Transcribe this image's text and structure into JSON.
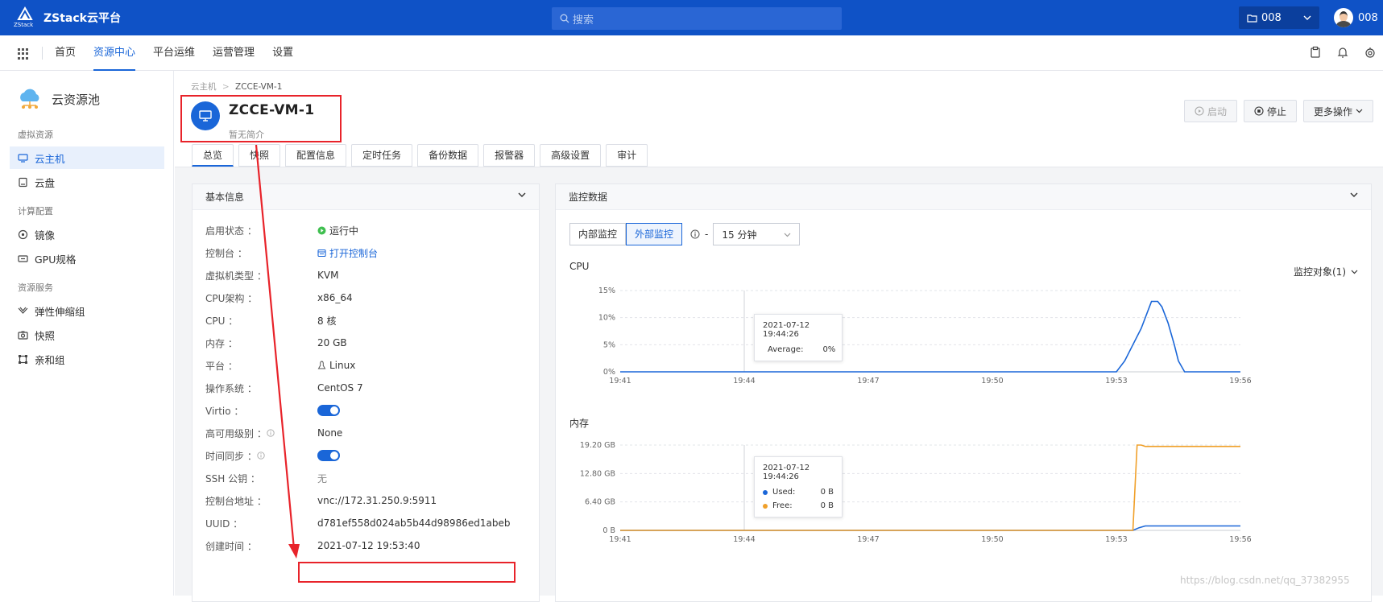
{
  "topbar": {
    "logo_sub": "ZStack",
    "app_name": "ZStack云平台",
    "search_placeholder": "搜索",
    "project": "008",
    "user": "008"
  },
  "nav": {
    "items": [
      {
        "label": "首页",
        "active": false
      },
      {
        "label": "资源中心",
        "active": true
      },
      {
        "label": "平台运维",
        "active": false
      },
      {
        "label": "运营管理",
        "active": false
      },
      {
        "label": "设置",
        "active": false
      }
    ]
  },
  "sidebar": {
    "pool_title": "云资源池",
    "sections": [
      {
        "title": "虚拟资源",
        "items": [
          {
            "label": "云主机",
            "icon": "monitor-icon",
            "active": true
          },
          {
            "label": "云盘",
            "icon": "disk-icon",
            "active": false
          }
        ]
      },
      {
        "title": "计算配置",
        "items": [
          {
            "label": "镜像",
            "icon": "image-icon",
            "active": false
          },
          {
            "label": "GPU规格",
            "icon": "gpu-icon",
            "active": false
          }
        ]
      },
      {
        "title": "资源服务",
        "items": [
          {
            "label": "弹性伸缩组",
            "icon": "scaling-icon",
            "active": false
          },
          {
            "label": "快照",
            "icon": "camera-icon",
            "active": false
          },
          {
            "label": "亲和组",
            "icon": "affinity-icon",
            "active": false
          }
        ]
      }
    ]
  },
  "breadcrumb": {
    "parent": "云主机",
    "sep": ">",
    "current": "ZCCE-VM-1"
  },
  "vm": {
    "name": "ZCCE-VM-1",
    "description": "暂无简介"
  },
  "actions": {
    "start": "启动",
    "stop": "停止",
    "more": "更多操作"
  },
  "tabs": [
    "总览",
    "快照",
    "配置信息",
    "定时任务",
    "备份数据",
    "报警器",
    "高级设置",
    "审计"
  ],
  "basic_info": {
    "title": "基本信息",
    "rows": [
      {
        "label": "启用状态 ：",
        "value": "运行中"
      },
      {
        "label": "控制台 ：",
        "value": "打开控制台"
      },
      {
        "label": "虚拟机类型 ：",
        "value": "KVM"
      },
      {
        "label": "CPU架构 ：",
        "value": "x86_64"
      },
      {
        "label": "CPU ：",
        "value": "8 核"
      },
      {
        "label": "内存 ：",
        "value": "20 GB"
      },
      {
        "label": "平台 ：",
        "value": "Linux"
      },
      {
        "label": "操作系统 ：",
        "value": "CentOS 7"
      },
      {
        "label": "Virtio ：",
        "value": ""
      },
      {
        "label": "高可用级别 ：",
        "value": "None"
      },
      {
        "label": "时间同步 ：",
        "value": ""
      },
      {
        "label": "SSH 公钥 ：",
        "value": "无"
      },
      {
        "label": "控制台地址 ：",
        "value": "vnc://172.31.250.9:5911"
      },
      {
        "label": "UUID ：",
        "value": "d781ef558d024ab5b44d98986ed1abeb"
      },
      {
        "label": "创建时间 ：",
        "value": "2021-07-12 19:53:40"
      }
    ]
  },
  "monitor": {
    "title": "监控数据",
    "internal": "内部监控",
    "external": "外部监控",
    "dash": "-",
    "range": "15 分钟",
    "target": "监控对象(1)"
  },
  "chart_data": [
    {
      "type": "line",
      "title": "CPU",
      "x": [
        "19:41",
        "19:44",
        "19:47",
        "19:50",
        "19:53",
        "19:56"
      ],
      "yticks": [
        "0%",
        "5%",
        "10%",
        "15%"
      ],
      "ylim": [
        0,
        15
      ],
      "series": [
        {
          "name": "Average",
          "color": "#1a66d8",
          "points": [
            [
              0,
              0
            ],
            [
              12.0,
              0
            ],
            [
              12.2,
              2
            ],
            [
              12.4,
              5
            ],
            [
              12.6,
              8
            ],
            [
              12.75,
              11
            ],
            [
              12.85,
              13
            ],
            [
              13.0,
              13
            ],
            [
              13.1,
              12
            ],
            [
              13.25,
              9
            ],
            [
              13.4,
              5
            ],
            [
              13.5,
              2
            ],
            [
              13.65,
              0
            ],
            [
              15,
              0
            ]
          ]
        }
      ],
      "tooltip": {
        "time": "2021-07-12 19:44:26",
        "rows": [
          {
            "label": "Average:",
            "value": "0%",
            "color": "#1a66d8"
          }
        ]
      }
    },
    {
      "type": "line",
      "title": "内存",
      "x": [
        "19:41",
        "19:44",
        "19:47",
        "19:50",
        "19:53",
        "19:56"
      ],
      "yticks": [
        "0 B",
        "6.40 GB",
        "12.80 GB",
        "19.20 GB"
      ],
      "ylim": [
        0,
        19.2
      ],
      "series": [
        {
          "name": "Used",
          "color": "#1a66d8",
          "points": [
            [
              0,
              0
            ],
            [
              12.4,
              0
            ],
            [
              12.55,
              0.6
            ],
            [
              12.7,
              1.0
            ],
            [
              15,
              1.0
            ]
          ]
        },
        {
          "name": "Free",
          "color": "#f0a02a",
          "points": [
            [
              0,
              0
            ],
            [
              12.4,
              0
            ],
            [
              12.5,
              19.2
            ],
            [
              12.6,
              19.2
            ],
            [
              12.7,
              18.9
            ],
            [
              15,
              18.9
            ]
          ]
        }
      ],
      "tooltip": {
        "time": "2021-07-12 19:44:26",
        "rows": [
          {
            "label": "Used:",
            "value": "0 B",
            "color": "#1a66d8"
          },
          {
            "label": "Free:",
            "value": "0 B",
            "color": "#f0a02a"
          }
        ]
      }
    }
  ],
  "watermark": "https://blog.csdn.net/qq_37382955"
}
